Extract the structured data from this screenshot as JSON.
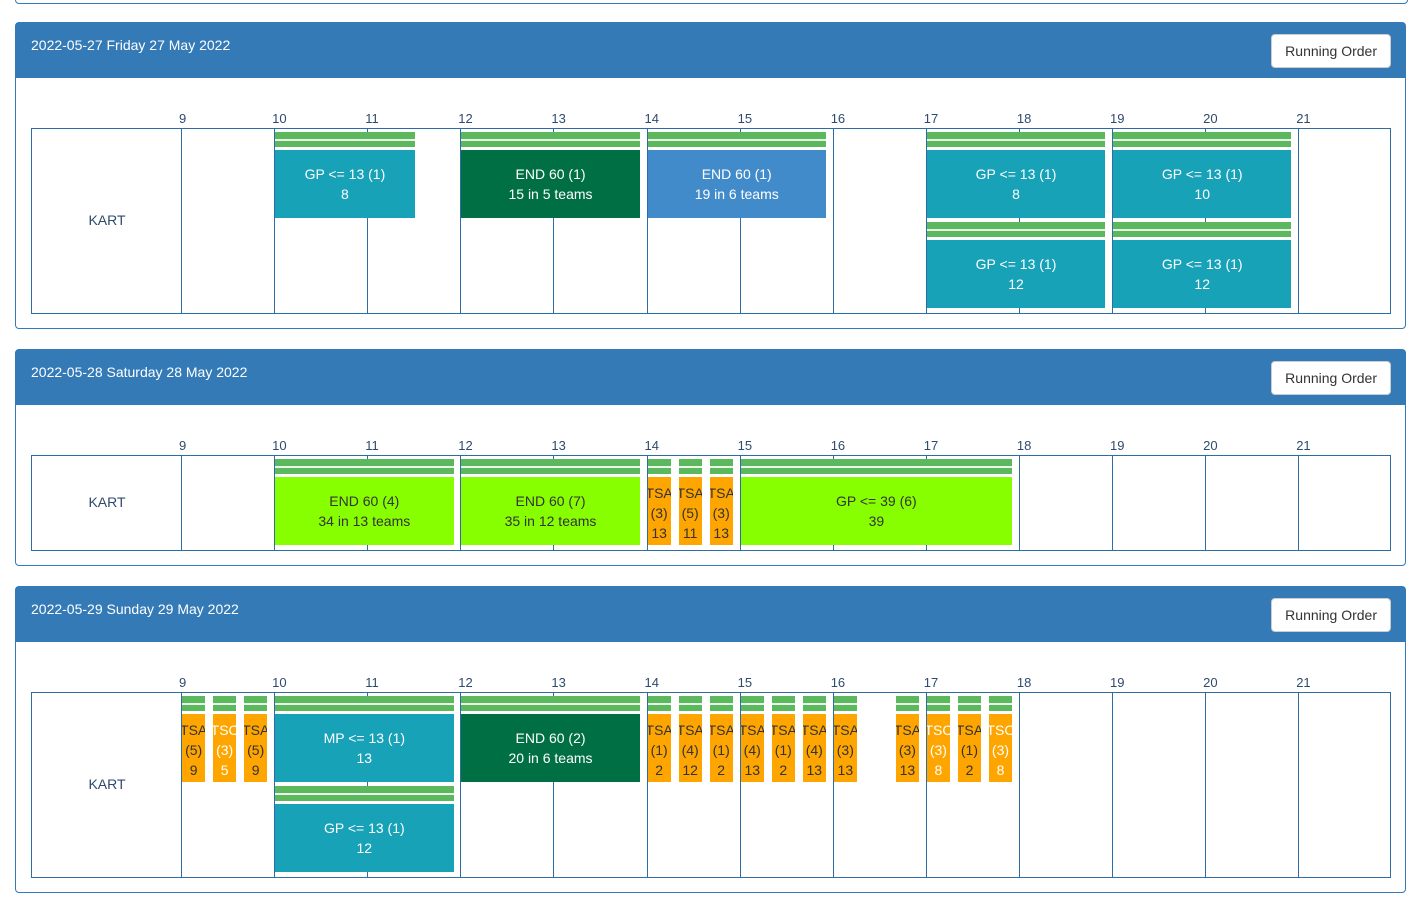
{
  "days": [
    {
      "title": "2022-05-27 Friday 27 May 2022",
      "button": "Running Order",
      "hours": [
        "9",
        "10",
        "11",
        "12",
        "13",
        "14",
        "15",
        "16",
        "17",
        "18",
        "19",
        "20",
        "21"
      ],
      "row_label": "KART",
      "grid_height": 186,
      "events": [
        {
          "start": "10:00",
          "end": "11:30",
          "lane": 0,
          "lines": [
            "GP <= 13 (1)",
            "8"
          ],
          "color": "#17a2b8",
          "text_color": "#ffffff"
        },
        {
          "start": "12:00",
          "end": "13:55",
          "lane": 0,
          "lines": [
            "END 60 (1)",
            "15 in 5 teams"
          ],
          "color": "#007044",
          "text_color": "#ffffff"
        },
        {
          "start": "14:00",
          "end": "15:55",
          "lane": 0,
          "lines": [
            "END 60 (1)",
            "19 in 6 teams"
          ],
          "color": "#428bca",
          "text_color": "#ffffff"
        },
        {
          "start": "17:00",
          "end": "18:55",
          "lane": 0,
          "lines": [
            "GP <= 13 (1)",
            "8"
          ],
          "color": "#17a2b8",
          "text_color": "#ffffff"
        },
        {
          "start": "19:00",
          "end": "20:55",
          "lane": 0,
          "lines": [
            "GP <= 13 (1)",
            "10"
          ],
          "color": "#17a2b8",
          "text_color": "#ffffff"
        },
        {
          "start": "17:00",
          "end": "18:55",
          "lane": 1,
          "lines": [
            "GP <= 13 (1)",
            "12"
          ],
          "color": "#17a2b8",
          "text_color": "#ffffff"
        },
        {
          "start": "19:00",
          "end": "20:55",
          "lane": 1,
          "lines": [
            "GP <= 13 (1)",
            "12"
          ],
          "color": "#17a2b8",
          "text_color": "#ffffff"
        }
      ]
    },
    {
      "title": "2022-05-28 Saturday 28 May 2022",
      "button": "Running Order",
      "hours": [
        "9",
        "10",
        "11",
        "12",
        "13",
        "14",
        "15",
        "16",
        "17",
        "18",
        "19",
        "20",
        "21"
      ],
      "row_label": "KART",
      "grid_height": 96,
      "events": [
        {
          "start": "10:00",
          "end": "11:55",
          "lane": 0,
          "lines": [
            "END 60 (4)",
            "34 in 13 teams"
          ],
          "color": "#88ff00",
          "text_color": "#333333"
        },
        {
          "start": "12:00",
          "end": "13:55",
          "lane": 0,
          "lines": [
            "END 60 (7)",
            "35 in 12 teams"
          ],
          "color": "#88ff00",
          "text_color": "#333333"
        },
        {
          "start": "14:00",
          "end": "14:15",
          "lane": 0,
          "lines": [
            "TSA",
            "(3)",
            "13"
          ],
          "color": "#ffa500",
          "text_color": "#333333",
          "small": true
        },
        {
          "start": "14:20",
          "end": "14:35",
          "lane": 0,
          "lines": [
            "TSA",
            "(5)",
            "11"
          ],
          "color": "#ffa500",
          "text_color": "#333333",
          "small": true
        },
        {
          "start": "14:40",
          "end": "14:55",
          "lane": 0,
          "lines": [
            "TSA",
            "(3)",
            "13"
          ],
          "color": "#ffa500",
          "text_color": "#333333",
          "small": true
        },
        {
          "start": "15:00",
          "end": "17:55",
          "lane": 0,
          "lines": [
            "GP <= 39 (6)",
            "39"
          ],
          "color": "#88ff00",
          "text_color": "#333333"
        }
      ]
    },
    {
      "title": "2022-05-29 Sunday 29 May 2022",
      "button": "Running Order",
      "hours": [
        "9",
        "10",
        "11",
        "12",
        "13",
        "14",
        "15",
        "16",
        "17",
        "18",
        "19",
        "20",
        "21"
      ],
      "row_label": "KART",
      "grid_height": 186,
      "events": [
        {
          "start": "9:00",
          "end": "9:15",
          "lane": 0,
          "lines": [
            "TSA",
            "(5)",
            "9"
          ],
          "color": "#ffa500",
          "text_color": "#333333",
          "small": true
        },
        {
          "start": "9:20",
          "end": "9:35",
          "lane": 0,
          "lines": [
            "TSC",
            "(3)",
            "5"
          ],
          "color": "#ffa500",
          "text_color": "#ffffff",
          "small": true
        },
        {
          "start": "9:40",
          "end": "9:55",
          "lane": 0,
          "lines": [
            "TSA",
            "(5)",
            "9"
          ],
          "color": "#ffa500",
          "text_color": "#333333",
          "small": true
        },
        {
          "start": "10:00",
          "end": "11:55",
          "lane": 0,
          "lines": [
            "MP <= 13 (1)",
            "13"
          ],
          "color": "#17a2b8",
          "text_color": "#ffffff"
        },
        {
          "start": "12:00",
          "end": "13:55",
          "lane": 0,
          "lines": [
            "END 60 (2)",
            "20 in 6 teams"
          ],
          "color": "#007044",
          "text_color": "#ffffff"
        },
        {
          "start": "14:00",
          "end": "14:15",
          "lane": 0,
          "lines": [
            "TSA",
            "(1)",
            "2"
          ],
          "color": "#ffa500",
          "text_color": "#333333",
          "small": true
        },
        {
          "start": "14:20",
          "end": "14:35",
          "lane": 0,
          "lines": [
            "TSA",
            "(4)",
            "12"
          ],
          "color": "#ffa500",
          "text_color": "#333333",
          "small": true
        },
        {
          "start": "14:40",
          "end": "14:55",
          "lane": 0,
          "lines": [
            "TSA",
            "(1)",
            "2"
          ],
          "color": "#ffa500",
          "text_color": "#333333",
          "small": true
        },
        {
          "start": "15:00",
          "end": "15:15",
          "lane": 0,
          "lines": [
            "TSA",
            "(4)",
            "13"
          ],
          "color": "#ffa500",
          "text_color": "#333333",
          "small": true
        },
        {
          "start": "15:20",
          "end": "15:35",
          "lane": 0,
          "lines": [
            "TSA",
            "(1)",
            "2"
          ],
          "color": "#ffa500",
          "text_color": "#333333",
          "small": true
        },
        {
          "start": "15:40",
          "end": "15:55",
          "lane": 0,
          "lines": [
            "TSA",
            "(4)",
            "13"
          ],
          "color": "#ffa500",
          "text_color": "#333333",
          "small": true
        },
        {
          "start": "16:00",
          "end": "16:15",
          "lane": 0,
          "lines": [
            "TSA",
            "(3)",
            "13"
          ],
          "color": "#ffa500",
          "text_color": "#333333",
          "small": true
        },
        {
          "start": "16:40",
          "end": "16:55",
          "lane": 0,
          "lines": [
            "TSA",
            "(3)",
            "13"
          ],
          "color": "#ffa500",
          "text_color": "#333333",
          "small": true
        },
        {
          "start": "17:00",
          "end": "17:15",
          "lane": 0,
          "lines": [
            "TSC",
            "(3)",
            "8"
          ],
          "color": "#ffa500",
          "text_color": "#ffffff",
          "small": true
        },
        {
          "start": "17:20",
          "end": "17:35",
          "lane": 0,
          "lines": [
            "TSA",
            "(1)",
            "2"
          ],
          "color": "#ffa500",
          "text_color": "#333333",
          "small": true
        },
        {
          "start": "17:40",
          "end": "17:55",
          "lane": 0,
          "lines": [
            "TSC",
            "(3)",
            "8"
          ],
          "color": "#ffa500",
          "text_color": "#ffffff",
          "small": true
        },
        {
          "start": "10:00",
          "end": "11:55",
          "lane": 1,
          "lines": [
            "GP <= 13 (1)",
            "12"
          ],
          "color": "#17a2b8",
          "text_color": "#ffffff"
        }
      ]
    }
  ]
}
